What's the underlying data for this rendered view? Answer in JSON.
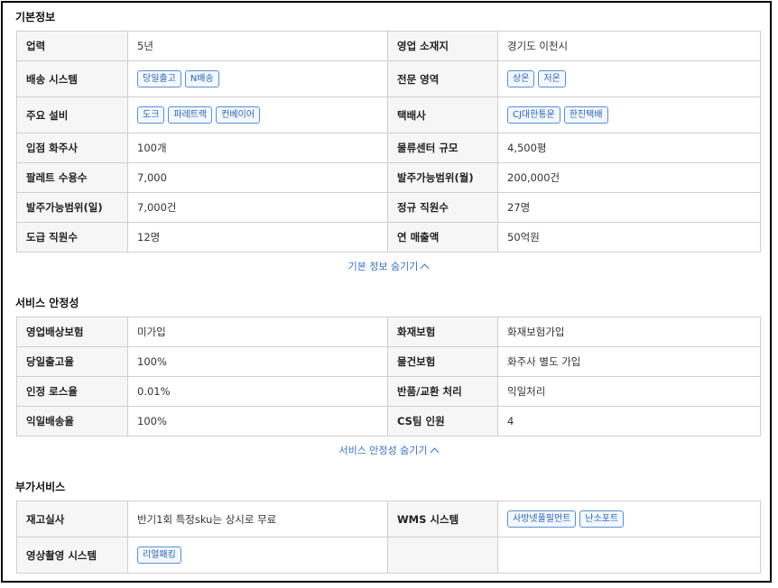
{
  "basic": {
    "title": "기본정보",
    "rows": [
      {
        "l1": "업력",
        "v1": "5년",
        "l2": "영업 소재지",
        "v2": "경기도 이천시"
      },
      {
        "l1": "배송 시스템",
        "t1": [
          "당일출고",
          "N배송"
        ],
        "l2": "전문 영역",
        "t2": [
          "상온",
          "저온"
        ]
      },
      {
        "l1": "주요 설비",
        "t1": [
          "도크",
          "파레트랙",
          "컨베이어"
        ],
        "l2": "택배사",
        "t2": [
          "CJ대한통운",
          "한진택배"
        ]
      },
      {
        "l1": "입점 화주사",
        "v1": "100개",
        "l2": "물류센터 규모",
        "v2": "4,500평"
      },
      {
        "l1": "팔레트 수용수",
        "v1": "7,000",
        "l2": "발주가능범위(월)",
        "v2": "200,000건"
      },
      {
        "l1": "발주가능범위(일)",
        "v1": "7,000건",
        "l2": "정규 직원수",
        "v2": "27명"
      },
      {
        "l1": "도급 직원수",
        "v1": "12명",
        "l2": "연 매출액",
        "v2": "50억원"
      }
    ],
    "toggle_label": "기본 정보 숨기기"
  },
  "stability": {
    "title": "서비스 안정성",
    "rows": [
      {
        "l1": "영업배상보험",
        "v1": "미가입",
        "l2": "화재보험",
        "v2": "화재보험가입"
      },
      {
        "l1": "당일출고율",
        "v1": "100%",
        "l2": "물건보험",
        "v2": "화주사 별도 가입"
      },
      {
        "l1": "인정 로스율",
        "v1": "0.01%",
        "l2": "반품/교환 처리",
        "v2": "익일처리"
      },
      {
        "l1": "익일배송율",
        "v1": "100%",
        "l2": "CS팀 인원",
        "v2": "4"
      }
    ],
    "toggle_label": "서비스 안정성 숨기기"
  },
  "extra": {
    "title": "부가서비스",
    "rows": [
      {
        "l1": "재고실사",
        "v1": "반기1회 특정sku는 상시로 무료",
        "l2": "WMS 시스템",
        "t2": [
          "사방넷풀필먼트",
          "난소포트"
        ]
      },
      {
        "l1": "영상촬영 시스템",
        "t1": [
          "리얼패킹"
        ],
        "l2": "",
        "v2": ""
      }
    ]
  }
}
